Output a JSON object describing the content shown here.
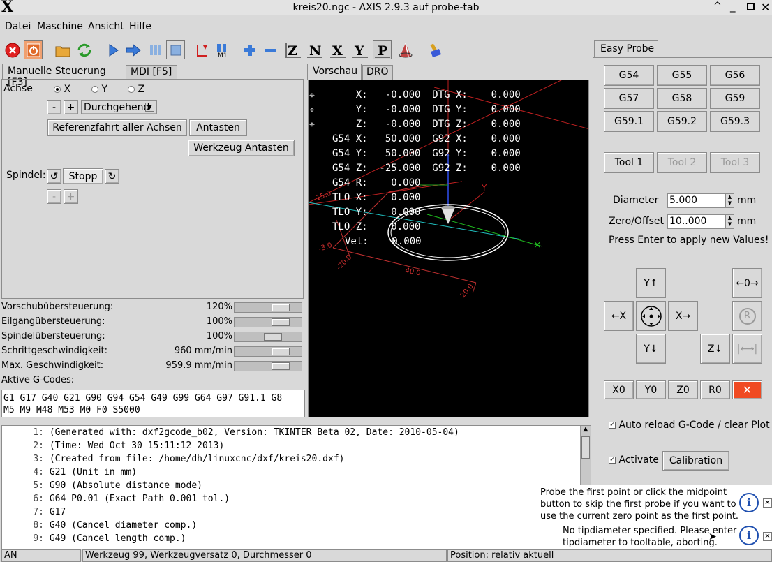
{
  "window": {
    "title": "kreis20.ngc - AXIS 2.9.3 auf probe-tab",
    "logo": "X"
  },
  "menu": [
    "Datei",
    "Maschine",
    "Ansicht",
    "Hilfe"
  ],
  "toolbar": [
    "estop-icon",
    "power-icon",
    "open-icon",
    "reload-icon",
    "run-icon",
    "step-icon",
    "pause-icon",
    "stop-icon",
    "touchoff-icon",
    "m1-icon",
    "zoom-in-icon",
    "zoom-out-icon",
    "view-z-icon",
    "view-z2-icon",
    "view-x-icon",
    "view-y-icon",
    "view-p-icon",
    "rotate-icon",
    "clear-plot-icon"
  ],
  "left_tabs": {
    "manual": "Manuelle Steuerung [F3]",
    "mdi": "MDI [F5]"
  },
  "manual": {
    "axis_label": "Achse",
    "axes": [
      "X",
      "Y",
      "Z"
    ],
    "selected_axis": "X",
    "jog_minus": "-",
    "jog_plus": "+",
    "jog_mode": "Durchgehend",
    "home_all": "Referenzfahrt aller Achsen",
    "touch_off": "Antasten",
    "tool_touch_off": "Werkzeug Antasten",
    "spindle_label": "Spindel:",
    "spindle_stop": "Stopp",
    "spindle_minus": "-",
    "spindle_plus": "+"
  },
  "overrides": [
    {
      "label": "Vorschubübersteuerung:",
      "value": "120",
      "unit": "%",
      "level": 0.75
    },
    {
      "label": "Eilgangübersteuerung:",
      "value": "100",
      "unit": "%",
      "level": 0.75
    },
    {
      "label": "Spindelübersteuerung:",
      "value": "100",
      "unit": "%",
      "level": 0.6
    },
    {
      "label": "Schrittgeschwindigkeit:",
      "value": "960 mm/min",
      "unit": "",
      "level": 0.75
    },
    {
      "label": "Max. Geschwindigkeit:",
      "value": "959.9 mm/min",
      "unit": "",
      "level": 0.75
    }
  ],
  "active_gcodes": {
    "label": "Aktive G-Codes:",
    "line1": "G1 G17 G40 G21 G90 G94 G54 G49 G99 G64 G97 G91.1 G8",
    "line2": "M5 M9 M48 M53 M0 F0 S5000"
  },
  "preview_tabs": {
    "preview": "Vorschau",
    "dro": "DRO"
  },
  "dro_lines": [
    "    X:   -0.000  DTG X:    0.000",
    "    Y:   -0.000  DTG Y:    0.000",
    "    Z:   -0.000  DTG Z:    0.000",
    "G54 X:   50.000  G92 X:    0.000",
    "G54 Y:   50.000  G92 Y:    0.000",
    "G54 Z:  -25.000  G92 Z:    0.000",
    "G54 R:    0.000",
    "TLO X:    0.000",
    "TLO Y:    0.000",
    "TLO Z:    0.000",
    "Vel:    0.000"
  ],
  "plot_labels": {
    "l1": "15.0",
    "l2": "-3.0",
    "l3": "-20.0",
    "l4": "40.0",
    "l5": "20.0"
  },
  "gcode": [
    {
      "n": "1:",
      "text": "(Generated with: dxf2gcode_b02, Version: TKINTER Beta 02, Date: 2010-05-04)"
    },
    {
      "n": "2:",
      "text": "(Time: Wed Oct 30 15:11:12 2013)"
    },
    {
      "n": "3:",
      "text": "(Created from file: /home/dh/linuxcnc/dxf/kreis20.dxf)"
    },
    {
      "n": "4:",
      "text": "G21 (Unit in mm)"
    },
    {
      "n": "5:",
      "text": "G90 (Absolute distance mode)"
    },
    {
      "n": "6:",
      "text": "G64 P0.01 (Exact Path 0.001 tol.)"
    },
    {
      "n": "7:",
      "text": "G17"
    },
    {
      "n": "8:",
      "text": "G40 (Cancel diameter comp.)"
    },
    {
      "n": "9:",
      "text": "G49 (Cancel length comp.)"
    }
  ],
  "status": {
    "state": "AN",
    "tool": "Werkzeug 99, Werkzeugversatz 0, Durchmesser 0",
    "position": "Position: relativ aktuell"
  },
  "probe": {
    "tab": "Easy Probe",
    "offsets": [
      "G54",
      "G55",
      "G56",
      "G57",
      "G58",
      "G59",
      "G59.1",
      "G59.2",
      "G59.3"
    ],
    "tools": [
      "Tool 1",
      "Tool 2",
      "Tool 3"
    ],
    "diameter_label": "Diameter",
    "diameter_value": "5.000",
    "diameter_unit": "mm",
    "zero_label": "Zero/Offset",
    "zero_value": "10..000",
    "zero_unit": "mm",
    "hint": "Press Enter to apply new Values!",
    "jog": {
      "yplus": "Y↑",
      "yminus": "Y↓",
      "xminus": "←X",
      "xplus": "X→",
      "zminus": "Z↓",
      "zero": "←0→",
      "rot": "R"
    },
    "zero_buttons": [
      "X0",
      "Y0",
      "Z0",
      "R0"
    ],
    "auto_reload": "Auto reload G-Code / clear Plot",
    "activate": "Activate",
    "calibration": "Calibration"
  },
  "notifications": [
    "Probe the first point or click the midpoint button to skip the first probe if you want to use the current zero point as the first point.",
    "No tipdiameter specified. Please enter tipdiameter to tooltable, aborting."
  ],
  "colors": {
    "estop": "#e02020",
    "clear": "#f04a22",
    "plot_bg": "#000000"
  }
}
